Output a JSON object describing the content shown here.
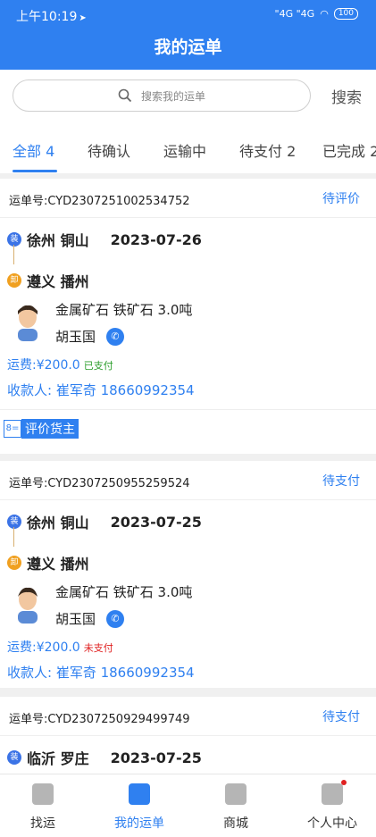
{
  "status_bar": {
    "time": "上午10:19",
    "network": "\"4G \"4G",
    "battery": "100"
  },
  "header": {
    "title": "我的运单"
  },
  "search": {
    "placeholder": "搜索我的运单",
    "button": "搜索"
  },
  "tabs": [
    {
      "label": "全部 4"
    },
    {
      "label": "待确认"
    },
    {
      "label": "运输中"
    },
    {
      "label": "待支付 2"
    },
    {
      "label": "已完成 2"
    }
  ],
  "orders": [
    {
      "order_no": "运单号:CYD2307251002534752",
      "status": "待评价",
      "from": "徐州 铜山",
      "date": "2023-07-26",
      "to": "遵义 播州",
      "load_badge": "装",
      "unload_badge": "卸",
      "goods": "金属矿石  铁矿石 3.0吨",
      "driver": "胡玉国",
      "fee": "运费:¥200.0",
      "pay_status": "已支付",
      "payee": "收款人:  崔军奇  18660992354",
      "action": "评价货主"
    },
    {
      "order_no": "运单号:CYD2307250955259524",
      "status": "待支付",
      "from": "徐州 铜山",
      "date": "2023-07-25",
      "to": "遵义 播州",
      "load_badge": "装",
      "unload_badge": "卸",
      "goods": "金属矿石  铁矿石 3.0吨",
      "driver": "胡玉国",
      "fee": "运费:¥200.0",
      "pay_status": "未支付",
      "payee": "收款人:  崔军奇  18660992354"
    },
    {
      "order_no": "运单号:CYD2307250929499749",
      "status": "待支付",
      "from": "临沂 罗庄",
      "date": "2023-07-25",
      "load_badge": "装"
    }
  ],
  "bottom_nav": [
    {
      "label": "找运"
    },
    {
      "label": "我的运单"
    },
    {
      "label": "商城"
    },
    {
      "label": "个人中心"
    }
  ],
  "colors": {
    "primary": "#2f80f0",
    "paid": "#2a9d2a",
    "unpaid": "#e02020"
  }
}
